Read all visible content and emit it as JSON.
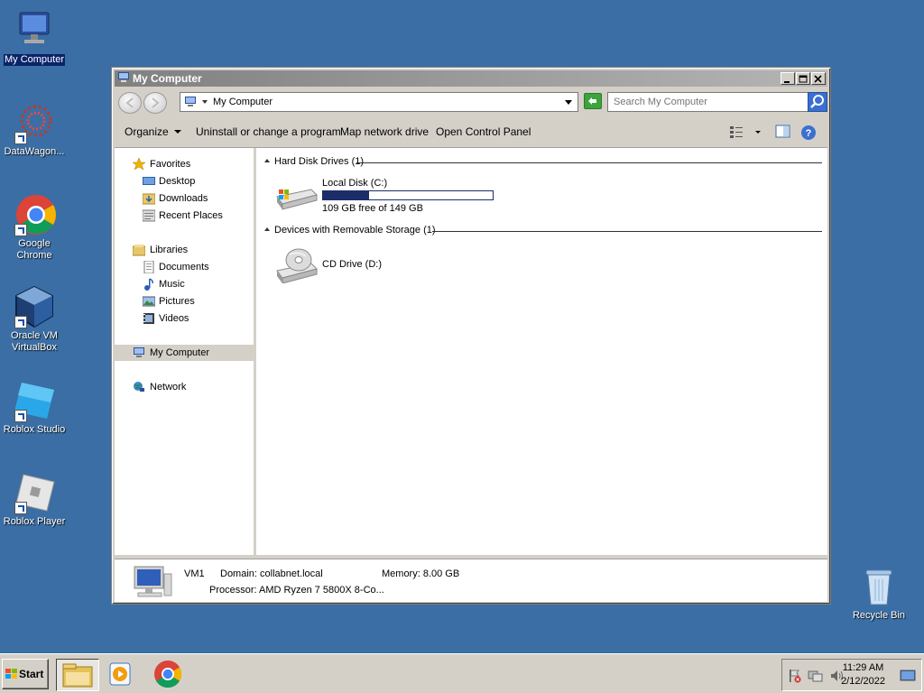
{
  "desktop": {
    "icons": [
      {
        "label": "My Computer",
        "icon": "computer-icon"
      },
      {
        "label": "DataWagon...",
        "icon": "datawagon-icon"
      },
      {
        "label": "Google Chrome",
        "icon": "chrome-icon"
      },
      {
        "label": "Oracle VM VirtualBox",
        "icon": "virtualbox-icon"
      },
      {
        "label": "Roblox Studio",
        "icon": "roblox-studio-icon"
      },
      {
        "label": "Roblox Player",
        "icon": "roblox-player-icon"
      },
      {
        "label": "Recycle Bin",
        "icon": "recycle-bin-icon"
      }
    ]
  },
  "window": {
    "title": "My Computer",
    "address": "My Computer",
    "search_placeholder": "Search My Computer",
    "toolbar": {
      "organize": "Organize",
      "uninstall": "Uninstall or change a program",
      "map_drive": "Map network drive",
      "control_panel": "Open Control Panel"
    },
    "nav": {
      "favorites": "Favorites",
      "desktop": "Desktop",
      "downloads": "Downloads",
      "recent": "Recent Places",
      "libraries": "Libraries",
      "documents": "Documents",
      "music": "Music",
      "pictures": "Pictures",
      "videos": "Videos",
      "my_computer": "My Computer",
      "network": "Network"
    },
    "groups": {
      "hdd_header": "Hard Disk Drives (1)",
      "removable_header": "Devices with Removable Storage (1)"
    },
    "drives": {
      "local_disk": {
        "name": "Local Disk (C:)",
        "free_text": "109 GB free of 149 GB",
        "used_fraction": 0.27
      },
      "cd_drive": {
        "name": "CD Drive (D:)"
      }
    },
    "details": {
      "computer_name": "VM1",
      "domain": "Domain: collabnet.local",
      "memory": "Memory: 8.00 GB",
      "processor": "Processor: AMD Ryzen 7 5800X 8-Co..."
    }
  },
  "taskbar": {
    "start_label": "Start",
    "time": "11:29 AM",
    "date": "2/12/2022"
  }
}
